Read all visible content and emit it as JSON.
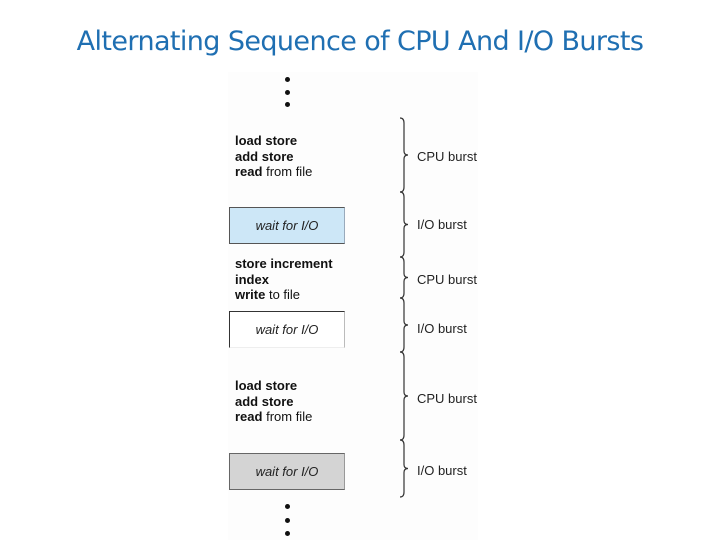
{
  "title": "Alternating Sequence of CPU And I/O Bursts",
  "colors": {
    "title": "#1f6fb2",
    "io_box_1": "#cde7f7",
    "io_box_2": "#ffffff",
    "io_box_3": "#d4d4d4"
  },
  "diagram": {
    "ellipsis_top": "⋮",
    "ellipsis_bottom": "⋮",
    "segments": [
      {
        "type": "cpu",
        "lines": [
          {
            "bold": "load store",
            "rest": ""
          },
          {
            "bold": "add store",
            "rest": ""
          },
          {
            "bold": "read",
            "rest": " from file"
          }
        ],
        "label": "CPU burst"
      },
      {
        "type": "io",
        "box_text": "wait for I/O",
        "label": "I/O burst"
      },
      {
        "type": "cpu",
        "lines": [
          {
            "bold": "store increment",
            "rest": ""
          },
          {
            "bold": "index",
            "rest": ""
          },
          {
            "bold": "write",
            "rest": " to file"
          }
        ],
        "label": "CPU burst"
      },
      {
        "type": "io",
        "box_text": "wait for I/O",
        "label": "I/O burst"
      },
      {
        "type": "cpu",
        "lines": [
          {
            "bold": "load store",
            "rest": ""
          },
          {
            "bold": "add store",
            "rest": ""
          },
          {
            "bold": "read",
            "rest": " from file"
          }
        ],
        "label": "CPU burst"
      },
      {
        "type": "io",
        "box_text": "wait for I/O",
        "label": "I/O burst"
      }
    ]
  }
}
